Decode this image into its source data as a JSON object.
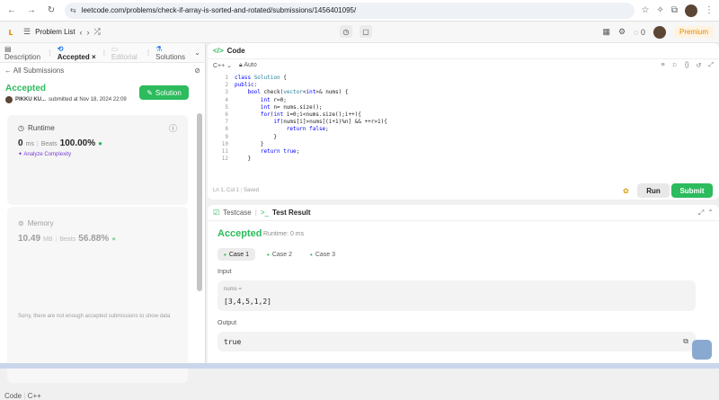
{
  "browser": {
    "url": "leetcode.com/problems/check-if-array-is-sorted-and-rotated/submissions/1456401095/"
  },
  "header": {
    "problem_list": "Problem List",
    "counter": "0",
    "premium": "Premium"
  },
  "left": {
    "tabs": [
      "Description",
      "Accepted",
      "Editorial",
      "Solutions"
    ],
    "all_submissions": "All Submissions",
    "status": "Accepted",
    "user": "PIKKU KU...",
    "submitted": "submitted at Nov 18, 2024 22:09",
    "solution_btn": "Solution",
    "runtime_label": "Runtime",
    "runtime_value": "0",
    "runtime_unit": "ms",
    "beats_label": "Beats",
    "runtime_beats": "100.00%",
    "analyze": "Analyze Complexity",
    "memory_label": "Memory",
    "memory_value": "10.49",
    "memory_unit": "MB",
    "memory_beats_label": "Beats",
    "memory_beats": "56.88%",
    "sorry": "Sorry, there are not enough accepted submissions to show data",
    "footer_code": "Code",
    "footer_lang": "C++"
  },
  "editor": {
    "title": "Code",
    "language": "C++",
    "mode": "Auto",
    "lines": [
      "class Solution {",
      "public:",
      "    bool check(vector<int>& nums) {",
      "        int r=0;",
      "        int n= nums.size();",
      "        for(int i=0;i<nums.size();i++){",
      "            if(nums[i]>nums[(i+1)%n] && ++r>1){",
      "                return false;",
      "            }",
      "        }",
      "        return true;",
      "    }"
    ],
    "status": "Ln 1, Col 1",
    "saved": "Saved",
    "run": "Run",
    "submit": "Submit"
  },
  "result": {
    "testcase_tab": "Testcase",
    "result_tab": "Test Result",
    "status": "Accepted",
    "runtime": "Runtime: 0 ms",
    "cases": [
      "Case 1",
      "Case 2",
      "Case 3"
    ],
    "input_label": "Input",
    "var_name": "nums =",
    "input_value": "[3,4,5,1,2]",
    "output_label": "Output",
    "output_value": "true"
  },
  "colors": {
    "accent_green": "#2cbb5d",
    "premium_orange": "#e08a00"
  }
}
